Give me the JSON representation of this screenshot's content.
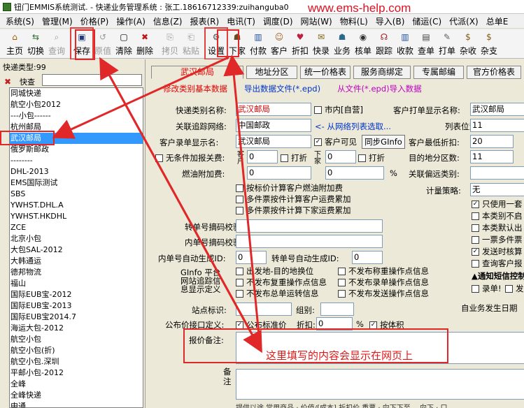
{
  "window": {
    "title": "钮门EMMIS系统测试. - 快递业务管理系统 : 张工.18616712339:zuihanguba0",
    "watermark": "www.ems-help.com"
  },
  "menu": [
    "系统(S)",
    "管理(M)",
    "价格(P)",
    "操作(A)",
    "信息(Z)",
    "报表(R)",
    "电讯(T)",
    "调度(D)",
    "网站(W)",
    "物料(L)",
    "导入(B)",
    "储运(C)",
    "代派(X)",
    "总单E"
  ],
  "toolbar": [
    {
      "label": "主页",
      "icon": "⌂"
    },
    {
      "label": "切换",
      "icon": "⇆"
    },
    {
      "label": "查询",
      "icon": "⌕"
    },
    {
      "label": "保存",
      "icon": "▣"
    },
    {
      "label": "原值",
      "icon": "↺"
    },
    {
      "label": "清除",
      "icon": "▢"
    },
    {
      "label": "删除",
      "icon": "✖"
    },
    {
      "label": "拷贝",
      "icon": "⎘"
    },
    {
      "label": "粘贴",
      "icon": "⎗"
    },
    {
      "label": "设置",
      "icon": "⚙"
    },
    {
      "label": "下家",
      "icon": "☗"
    },
    {
      "label": "付款",
      "icon": "▥"
    },
    {
      "label": "客户",
      "icon": "☺"
    },
    {
      "label": "折扣",
      "icon": "♥"
    },
    {
      "label": "快录",
      "icon": "✉"
    },
    {
      "label": "业务",
      "icon": "☗"
    },
    {
      "label": "核单",
      "icon": "◉"
    },
    {
      "label": "跟踪",
      "icon": "☊"
    },
    {
      "label": "收款",
      "icon": "▥"
    },
    {
      "label": "查单",
      "icon": "▤"
    },
    {
      "label": "打单",
      "icon": "✎"
    },
    {
      "label": "杂收",
      "icon": "$"
    },
    {
      "label": "杂支",
      "icon": "$"
    }
  ],
  "left": {
    "type_label": "快递类型:99",
    "search_label": "快查",
    "items": [
      "同城快递",
      "航空小包2012",
      "---小包------",
      "杭州邮局",
      "武汉邮局",
      "俄罗斯邮政",
      "--------",
      "DHL-2013",
      "EMS国际测试",
      "SBS",
      "YWHST.DHL.A",
      "YWHST.HKDHL",
      "ZCE",
      "北京小包",
      "大包SAL-2012",
      "大韩通运",
      "德邦物流",
      "福山",
      "国际EUB宝-2012",
      "国际EUB宝-2013",
      "国际EUB宝2014.7",
      "海运大包-2012",
      "航空小包",
      "航空小包(折)",
      "航空小包.深圳",
      "平邮小包-2012",
      "全峰",
      "全峰快递",
      "申通"
    ],
    "selected": "武汉邮局"
  },
  "tabs": [
    "武汉邮局",
    "地址分区",
    "统一价格表",
    "服务商绑定",
    "专属邮编",
    "官方价格表"
  ],
  "subtabs": [
    "修改类别基本数据",
    "导出数据文件(*.epd)",
    "从文件(*.epd)导入数据"
  ],
  "form": {
    "type_name_label": "快递类别名称:",
    "type_name_value": "武汉邮局",
    "city_check": "市内[自营]",
    "print_name_label": "客户打单显示名称:",
    "print_name_value": "武汉邮局",
    "track_net_label": "关联追踪网络:",
    "track_net_value": "中国邮政",
    "track_hint": "<- 从网络列表选取...",
    "list_pos_label": "列表位置:",
    "list_pos_value": "11",
    "cust_name_label": "客户录单显示名:",
    "cust_name_value": "武汉邮局",
    "cust_visible": "客户可见",
    "sync_button": "同步GInfo",
    "min_discount_label": "客户最低折扣:",
    "min_discount_value": "20",
    "uncond_fee": "无条件加报关费:",
    "cust_vert": "客户",
    "zero_a": "0",
    "print_a": "打折",
    "next_vert": "下家",
    "zero_b": "0",
    "print_b": "打折",
    "dest_zone_label": "目的地分区数:",
    "dest_zone_value": "11",
    "fuel_label": "燃油附加费:",
    "fuel_a": "0",
    "fuel_b": "0",
    "percent": "%",
    "remote_label": "关联偏远类别:",
    "chk_fuel": "按标价计算客户燃油附加费",
    "chk_multi_cust": "多件票按件计算客户运费累加",
    "chk_multi_next": "多件票按件计算下家运费累加",
    "strategy_label": "计量策略:",
    "strategy_value": "无",
    "right_chks": [
      "只使用一套",
      "本类别不启",
      "本类默认出",
      "一票多件票",
      "发送时核算",
      "查询客户报",
      "▲通知短信控制",
      "录单!"
    ],
    "right_chks_state": [
      true,
      false,
      false,
      false,
      true,
      false,
      false,
      false
    ],
    "send_chk": "发",
    "trans_check_label": "转单号摘码校验:",
    "inner_check_label": "内单号摘码校验:",
    "inner_auto_label": "内单号自动生成ID:",
    "inner_auto_value": "0",
    "trans_auto_label": "转单号自动生成ID:",
    "trans_auto_value": "0",
    "ginfo_label": "GInfo 平台",
    "web_track_label": "网站追踪信",
    "show_def_label": "息显示定义",
    "chk_dep_dest": "出发地-目的地换位",
    "chk_no_weigh": "不发布称重操作点信息",
    "chk_no_review": "不发布复重操作点信息",
    "chk_no_record": "不发布录单操作点信息",
    "chk_no_bill": "不发布总单运转信息",
    "chk_no_send": "不发布发送操作点信息",
    "station_label": "站点标识:",
    "group_label": "组别:",
    "own_business": "自业务发生日期",
    "publish_label": "公布价接口定义:",
    "publish_std": "公布标准价",
    "discount_label": "折扣:",
    "discount_value": "0",
    "percent2": "%",
    "by_discount": "按体积",
    "price_note_label": "报价备注:",
    "note_label": "备注",
    "bottom_hint": "提供以途   常用商品 · 价值/[成本]      折扣价        重票 · 向下下至   ，向下 · 口"
  },
  "annotation": {
    "text": "这里填写的内容会显示在网页上",
    "color": "#e01818"
  }
}
